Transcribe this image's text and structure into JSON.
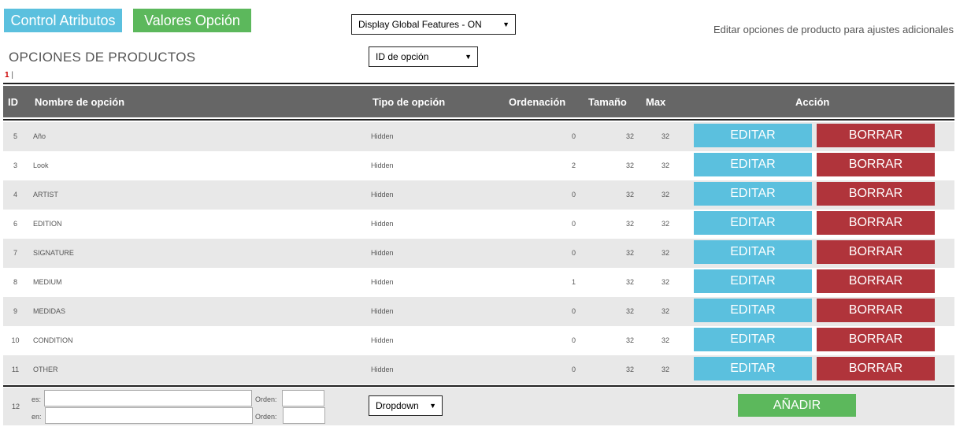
{
  "top": {
    "control_atributos": "Control Atributos",
    "valores_opcion": "Valores Opción",
    "global_select": "Display Global Features - ON",
    "info": "Editar opciones de producto para ajustes adicionales"
  },
  "page_title": "OPCIONES DE PRODUCTOS",
  "sort_select": "ID de opción",
  "pager": {
    "current": "1",
    "sep": "|"
  },
  "headers": {
    "id": "ID",
    "name": "Nombre de opción",
    "type": "Tipo de opción",
    "order": "Ordenación",
    "size": "Tamaño",
    "max": "Max",
    "action": "Acción"
  },
  "rows": [
    {
      "id": "5",
      "name": "Año",
      "type": "Hidden",
      "order": "0",
      "size": "32",
      "max": "32"
    },
    {
      "id": "3",
      "name": "Look",
      "type": "Hidden",
      "order": "2",
      "size": "32",
      "max": "32"
    },
    {
      "id": "4",
      "name": "ARTIST",
      "type": "Hidden",
      "order": "0",
      "size": "32",
      "max": "32"
    },
    {
      "id": "6",
      "name": "EDITION",
      "type": "Hidden",
      "order": "0",
      "size": "32",
      "max": "32"
    },
    {
      "id": "7",
      "name": "SIGNATURE",
      "type": "Hidden",
      "order": "0",
      "size": "32",
      "max": "32"
    },
    {
      "id": "8",
      "name": "MEDIUM",
      "type": "Hidden",
      "order": "1",
      "size": "32",
      "max": "32"
    },
    {
      "id": "9",
      "name": "MEDIDAS",
      "type": "Hidden",
      "order": "0",
      "size": "32",
      "max": "32"
    },
    {
      "id": "10",
      "name": "CONDITION",
      "type": "Hidden",
      "order": "0",
      "size": "32",
      "max": "32"
    },
    {
      "id": "11",
      "name": "OTHER",
      "type": "Hidden",
      "order": "0",
      "size": "32",
      "max": "32"
    }
  ],
  "actions": {
    "edit": "EDITAR",
    "delete": "BORRAR"
  },
  "add": {
    "new_id": "12",
    "lang_es": "es:",
    "lang_en": "en:",
    "orden_label": "Orden:",
    "type_select": "Dropdown",
    "button": "AÑADIR"
  },
  "colors": {
    "blue": "#5bc0de",
    "green": "#5cb85c",
    "red": "#b0343b",
    "header": "#666666"
  }
}
